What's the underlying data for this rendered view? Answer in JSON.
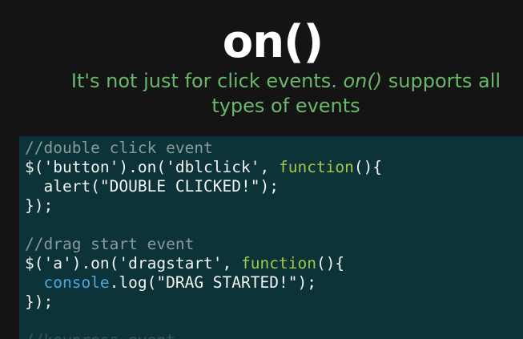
{
  "slide": {
    "title": "on()",
    "subtitle": {
      "part1": "It's not just for click events.  ",
      "em": "on()",
      "part2": " supports all",
      "line2": "types of events"
    }
  },
  "code": {
    "lines": [
      [
        {
          "t": "comment",
          "v": "//double click event"
        }
      ],
      [
        {
          "t": "plain",
          "v": "$('button').on('dblclick', "
        },
        {
          "t": "keyword",
          "v": "function"
        },
        {
          "t": "plain",
          "v": "(){"
        }
      ],
      [
        {
          "t": "plain",
          "v": "  alert(\"DOUBLE CLICKED!\");"
        }
      ],
      [
        {
          "t": "plain",
          "v": "});"
        }
      ],
      [
        {
          "t": "plain",
          "v": ""
        }
      ],
      [
        {
          "t": "comment",
          "v": "//drag start event"
        }
      ],
      [
        {
          "t": "plain",
          "v": "$('a').on('dragstart', "
        },
        {
          "t": "keyword",
          "v": "function"
        },
        {
          "t": "plain",
          "v": "(){"
        }
      ],
      [
        {
          "t": "plain",
          "v": "  "
        },
        {
          "t": "ident",
          "v": "console"
        },
        {
          "t": "plain",
          "v": ".log(\"DRAG STARTED!\");"
        }
      ],
      [
        {
          "t": "plain",
          "v": "});"
        }
      ],
      [
        {
          "t": "plain",
          "v": ""
        }
      ],
      [
        {
          "t": "comment",
          "v": "//keypress event"
        }
      ]
    ]
  },
  "colors": {
    "background": "#141414",
    "title": "#ffffff",
    "subtitle": "#69b86a",
    "code_background": "#0c3338",
    "code_text": "#f4f4f4",
    "code_comment": "#8a9a9b",
    "code_keyword": "#a3c74a",
    "code_identifier": "#4aa8e0"
  }
}
